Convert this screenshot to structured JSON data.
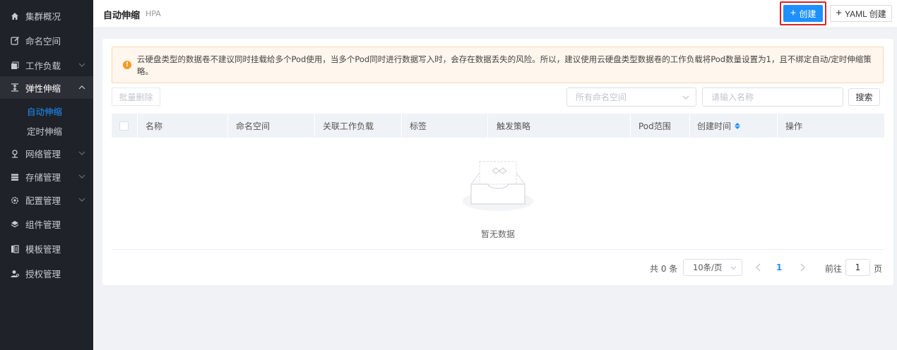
{
  "sidebar": {
    "items": [
      {
        "label": "集群概况",
        "icon": "home-icon"
      },
      {
        "label": "命名空间",
        "icon": "edit-icon"
      },
      {
        "label": "工作负载",
        "icon": "cube-icon"
      },
      {
        "label": "弹性伸缩",
        "icon": "scale-icon"
      },
      {
        "label": "网络管理",
        "icon": "network-icon"
      },
      {
        "label": "存储管理",
        "icon": "storage-icon"
      },
      {
        "label": "配置管理",
        "icon": "gear-icon"
      },
      {
        "label": "组件管理",
        "icon": "layers-icon"
      },
      {
        "label": "模板管理",
        "icon": "template-icon"
      },
      {
        "label": "授权管理",
        "icon": "user-key-icon"
      }
    ],
    "sub_items": [
      {
        "label": "自动伸缩",
        "active": true
      },
      {
        "label": "定时伸缩",
        "active": false
      }
    ]
  },
  "header": {
    "title": "自动伸缩",
    "subtitle": "HPA",
    "create_label": "创建",
    "yaml_create_label": "YAML 创建"
  },
  "alert": {
    "text": "云硬盘类型的数据卷不建议同时挂载给多个Pod使用，当多个Pod同时进行数据写入时，会存在数据丢失的风险。所以，建议使用云硬盘类型数据卷的工作负载将Pod数量设置为1，且不绑定自动/定时伸缩策略。"
  },
  "toolbar": {
    "batch_delete_label": "批量删除",
    "namespace_placeholder": "所有命名空间",
    "name_placeholder": "请输入名称",
    "search_label": "搜索"
  },
  "table": {
    "columns": [
      "名称",
      "命名空间",
      "关联工作负载",
      "标签",
      "触发策略",
      "Pod范围",
      "创建时间",
      "操作"
    ],
    "rows": [],
    "empty_text": "暂无数据"
  },
  "pagination": {
    "total_text": "共 0 条",
    "page_size": "10条/页",
    "current_page": "1",
    "goto_label": "前往",
    "goto_value": "1",
    "page_suffix": "页"
  },
  "colors": {
    "primary": "#1e90ff",
    "sidebar_bg": "#1f2228",
    "warning": "#f59a23",
    "highlight_border": "#e02020"
  }
}
